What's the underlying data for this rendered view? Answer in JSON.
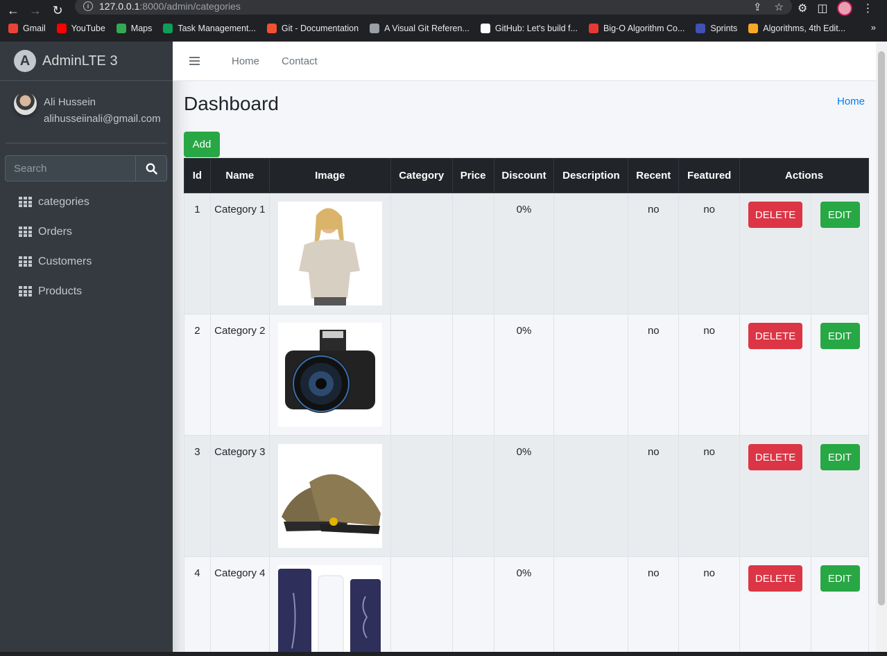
{
  "browser": {
    "url_host": "127.0.0.1",
    "url_path": ":8000/admin/categories",
    "bookmarks": [
      {
        "label": "Gmail",
        "color": "#ea4335"
      },
      {
        "label": "YouTube",
        "color": "#ff0000"
      },
      {
        "label": "Maps",
        "color": "#34a853"
      },
      {
        "label": "Task Management...",
        "color": "#0f9d58"
      },
      {
        "label": "Git - Documentation",
        "color": "#f05133"
      },
      {
        "label": "A Visual Git Referen...",
        "color": "#9aa0a6"
      },
      {
        "label": "GitHub: Let's build f...",
        "color": "#ffffff"
      },
      {
        "label": "Big-O Algorithm Co...",
        "color": "#e53935"
      },
      {
        "label": "Sprints",
        "color": "#3f51b5"
      },
      {
        "label": "Algorithms, 4th Edit...",
        "color": "#f9a825"
      }
    ]
  },
  "brand": {
    "text": "AdminLTE 3"
  },
  "user": {
    "name": "Ali Hussein",
    "email": "alihusseiinali@gmail.com"
  },
  "search": {
    "placeholder": "Search"
  },
  "menu": [
    {
      "label": "categories"
    },
    {
      "label": "Orders"
    },
    {
      "label": "Customers"
    },
    {
      "label": "Products"
    }
  ],
  "topnav": {
    "home": "Home",
    "contact": "Contact"
  },
  "content": {
    "title": "Dashboard",
    "breadcrumb": "Home",
    "add_label": "Add"
  },
  "table": {
    "headers": [
      "Id",
      "Name",
      "Image",
      "Category",
      "Price",
      "Discount",
      "Description",
      "Recent",
      "Featured",
      "Actions"
    ],
    "delete_label": "DELETE",
    "edit_label": "EDIT",
    "rows": [
      {
        "id": "1",
        "name": "Category 1",
        "image": "woman-sweater",
        "category": "",
        "price": "",
        "discount": "0%",
        "description": "",
        "recent": "no",
        "featured": "no"
      },
      {
        "id": "2",
        "name": "Category 2",
        "image": "camera",
        "category": "",
        "price": "",
        "discount": "0%",
        "description": "",
        "recent": "no",
        "featured": "no"
      },
      {
        "id": "3",
        "name": "Category 3",
        "image": "sneakers",
        "category": "",
        "price": "",
        "discount": "0%",
        "description": "",
        "recent": "no",
        "featured": "no"
      },
      {
        "id": "4",
        "name": "Category 4",
        "image": "skincare",
        "category": "",
        "price": "",
        "discount": "0%",
        "description": "",
        "recent": "no",
        "featured": "no"
      }
    ]
  }
}
